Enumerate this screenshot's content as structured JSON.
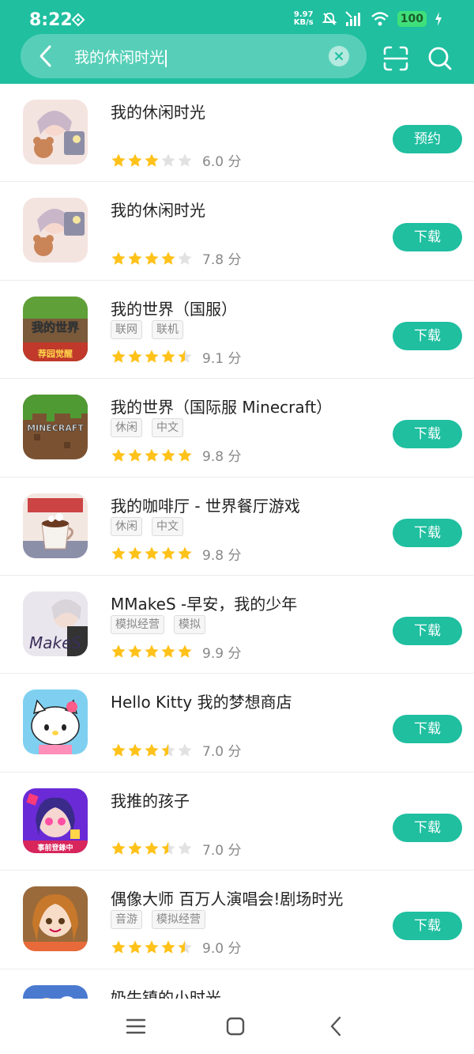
{
  "status": {
    "time": "8:22",
    "net_speed_value": "9.97",
    "net_speed_unit": "KB/s",
    "battery": "100"
  },
  "search": {
    "query": "我的休闲时光",
    "clear_icon": "close-icon"
  },
  "colors": {
    "accent": "#1fbfa0",
    "star": "#ffc21a",
    "star_empty": "#e2e2e2"
  },
  "apps": [
    {
      "title": "我的休闲时光",
      "tags": [],
      "rating": 3,
      "score": "6.0 分",
      "action": "预约"
    },
    {
      "title": "我的休闲时光",
      "tags": [],
      "rating": 4,
      "score": "7.8 分",
      "action": "下载"
    },
    {
      "title": "我的世界（国服）",
      "tags": [
        "联网",
        "联机"
      ],
      "rating": 4.5,
      "score": "9.1 分",
      "action": "下载"
    },
    {
      "title": "我的世界（国际服 Minecraft）",
      "tags": [
        "休闲",
        "中文"
      ],
      "rating": 5,
      "score": "9.8 分",
      "action": "下载"
    },
    {
      "title": "我的咖啡厅 - 世界餐厅游戏",
      "tags": [
        "休闲",
        "中文"
      ],
      "rating": 5,
      "score": "9.8 分",
      "action": "下载"
    },
    {
      "title": "MMakeS -早安，我的少年",
      "tags": [
        "模拟经营",
        "模拟"
      ],
      "rating": 5,
      "score": "9.9 分",
      "action": "下载"
    },
    {
      "title": "Hello Kitty 我的梦想商店",
      "tags": [],
      "rating": 3.5,
      "score": "7.0 分",
      "action": "下载"
    },
    {
      "title": "我推的孩子",
      "tags": [],
      "rating": 3.5,
      "score": "7.0 分",
      "action": "下载"
    },
    {
      "title": "偶像大师 百万人演唱会!剧场时光",
      "tags": [
        "音游",
        "模拟经营"
      ],
      "rating": 4.5,
      "score": "9.0 分",
      "action": "下载"
    },
    {
      "title": "奶牛镇的小时光",
      "tags": [],
      "rating": 0,
      "score": "",
      "action": ""
    }
  ],
  "icon_names": [
    "girl-with-bear-icon",
    "girl-with-bear-icon",
    "minecraft-china-icon",
    "minecraft-grass-block-icon",
    "coffee-cup-icon",
    "makes-game-icon",
    "hello-kitty-icon",
    "oshi-no-ko-icon",
    "idolmaster-icon",
    "farm-game-icon"
  ]
}
